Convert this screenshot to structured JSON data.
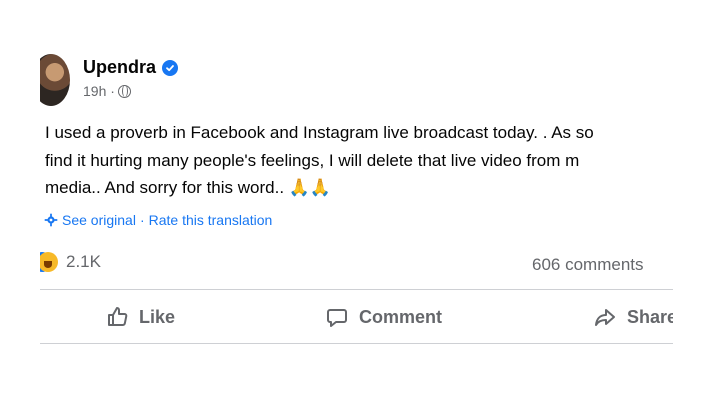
{
  "post": {
    "author": "Upendra",
    "time": "19h ·",
    "verified_icon": "verified-badge-icon",
    "privacy_icon": "globe-icon",
    "text_lines": [
      "I used a proverb in Facebook and Instagram live broadcast today. . As so",
      "find it hurting many people's feelings, I will delete that live video from m",
      "media.. And sorry for this word.. 🙏🙏"
    ],
    "translation": {
      "see_original": "See original",
      "separator": "·",
      "rate": "Rate this translation"
    },
    "reaction_count": "2.1K",
    "comments": "606 comments"
  },
  "actions": {
    "like": "Like",
    "comment": "Comment",
    "share": "Share"
  },
  "colors": {
    "accent": "#1877f2",
    "muted": "#65676b",
    "divider": "#ced0d4"
  }
}
